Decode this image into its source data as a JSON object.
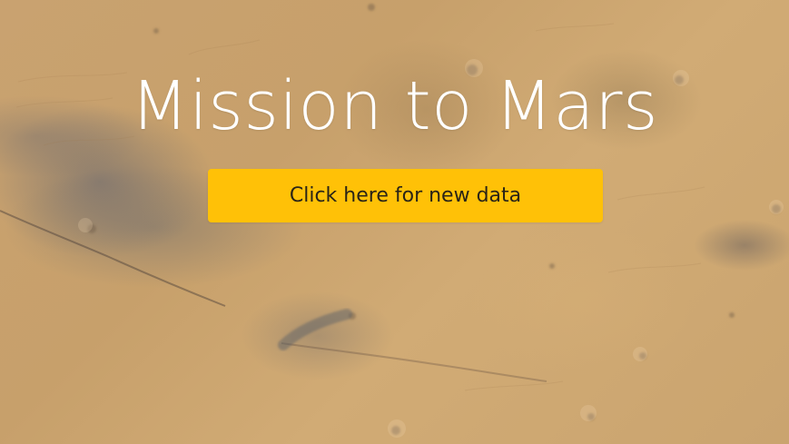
{
  "hero": {
    "title": "Mission to Mars",
    "button_label": "Click here for new data",
    "background_image": "mars-surface-photo"
  },
  "colors": {
    "button_background": "#ffc107",
    "title_text": "#ffffff"
  }
}
